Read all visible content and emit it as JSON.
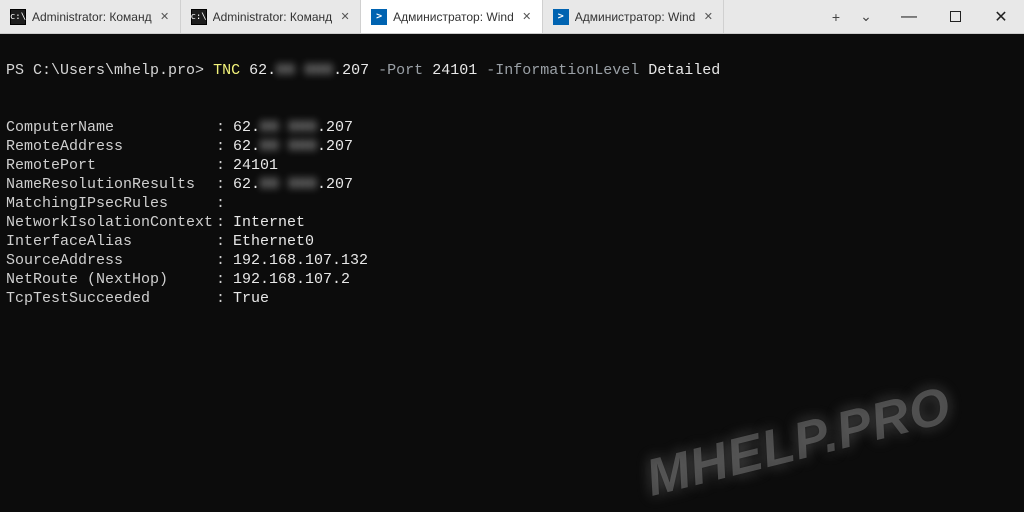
{
  "tabs": [
    {
      "label": "Administrator: Команд",
      "type": "cmd",
      "active": false
    },
    {
      "label": "Administrator: Команд",
      "type": "cmd",
      "active": false
    },
    {
      "label": "Администратор: Wind",
      "type": "ps",
      "active": true
    },
    {
      "label": "Администратор: Wind",
      "type": "ps",
      "active": false
    }
  ],
  "prompt": {
    "prefix": "PS C:\\Users\\mhelp.pro>",
    "cmd": "TNC",
    "ip_pre": "62.",
    "ip_mask": "00 000",
    "ip_post": ".207",
    "flag_port": "-Port",
    "port": "24101",
    "flag_info": "-InformationLevel",
    "info_val": "Detailed"
  },
  "results": [
    {
      "k": "ComputerName",
      "pre": "62.",
      "mask": "00 000",
      "post": ".207"
    },
    {
      "k": "RemoteAddress",
      "pre": "62.",
      "mask": "00 000",
      "post": ".207"
    },
    {
      "k": "RemotePort",
      "v": "24101"
    },
    {
      "k": "NameResolutionResults",
      "pre": "62.",
      "mask": "00 000",
      "post": ".207"
    },
    {
      "k": "MatchingIPsecRules",
      "v": ""
    },
    {
      "k": "NetworkIsolationContext",
      "v": "Internet"
    },
    {
      "k": "InterfaceAlias",
      "v": "Ethernet0"
    },
    {
      "k": "SourceAddress",
      "v": "192.168.107.132"
    },
    {
      "k": "NetRoute (NextHop)",
      "v": "192.168.107.2"
    },
    {
      "k": "TcpTestSucceeded",
      "v": "True"
    }
  ],
  "watermark": "MHELP.PRO",
  "glyph": {
    "plus": "+",
    "chev": "⌄",
    "min": "—",
    "close": "✕"
  }
}
